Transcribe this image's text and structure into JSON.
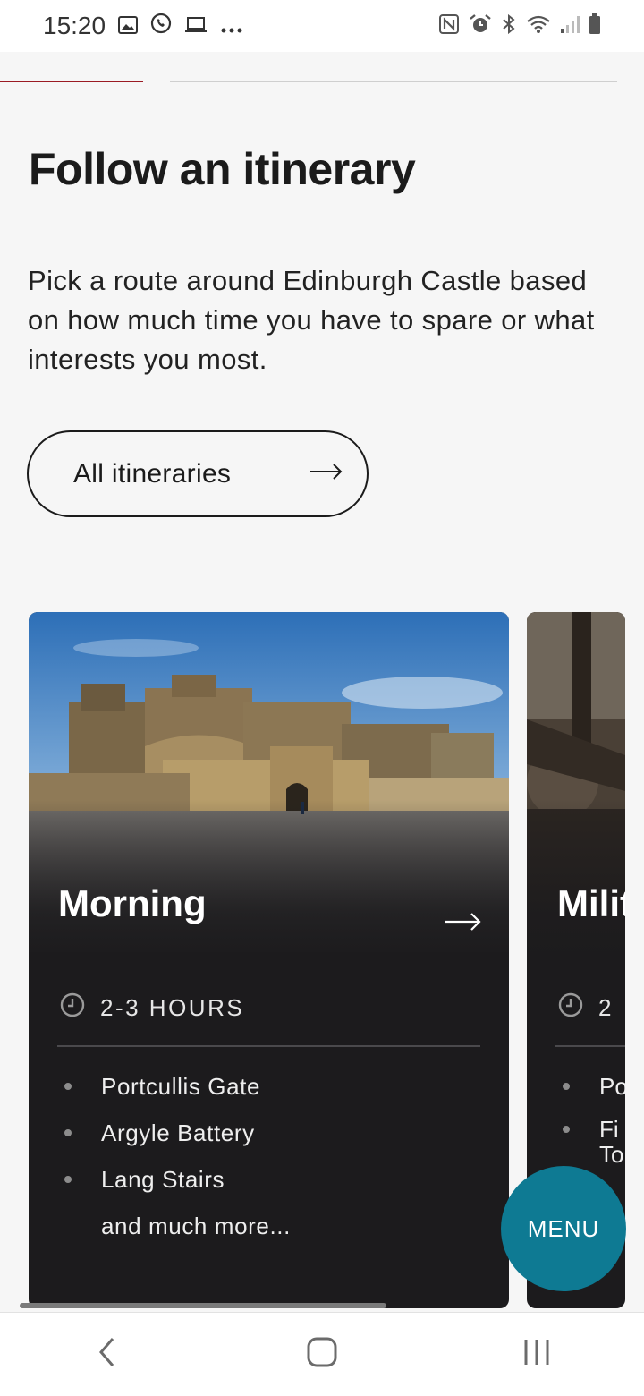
{
  "status_bar": {
    "time": "15:20",
    "left_icons": [
      "image-icon",
      "whatsapp-icon",
      "laptop-icon",
      "more-dots-icon"
    ],
    "right_icons": [
      "nfc-icon",
      "alarm-icon",
      "bluetooth-icon",
      "wifi-icon",
      "signal-icon",
      "battery-icon"
    ]
  },
  "page": {
    "title": "Follow an itinerary",
    "intro": "Pick a route around Edinburgh Castle based on how much time you have to spare or what interests you most.",
    "all_button_label": "All itineraries",
    "progress_segments": 2,
    "active_segment": 1
  },
  "cards": [
    {
      "title": "Morning",
      "duration": "2-3 HOURS",
      "stops": [
        "Portcullis Gate",
        "Argyle Battery",
        "Lang Stairs"
      ],
      "more": "and much more..."
    },
    {
      "title": "Milit",
      "duration": "2",
      "stops": [
        "Po",
        "Fi"
      ],
      "stop_second_line": "To"
    }
  ],
  "menu_button": {
    "label": "MENU",
    "color": "#0e7a93"
  },
  "colors": {
    "accent_red": "#9b1b24",
    "card_bg": "#1c1b1d"
  },
  "nav": {
    "back": "back-icon",
    "home": "home-icon",
    "recents": "recents-icon"
  }
}
